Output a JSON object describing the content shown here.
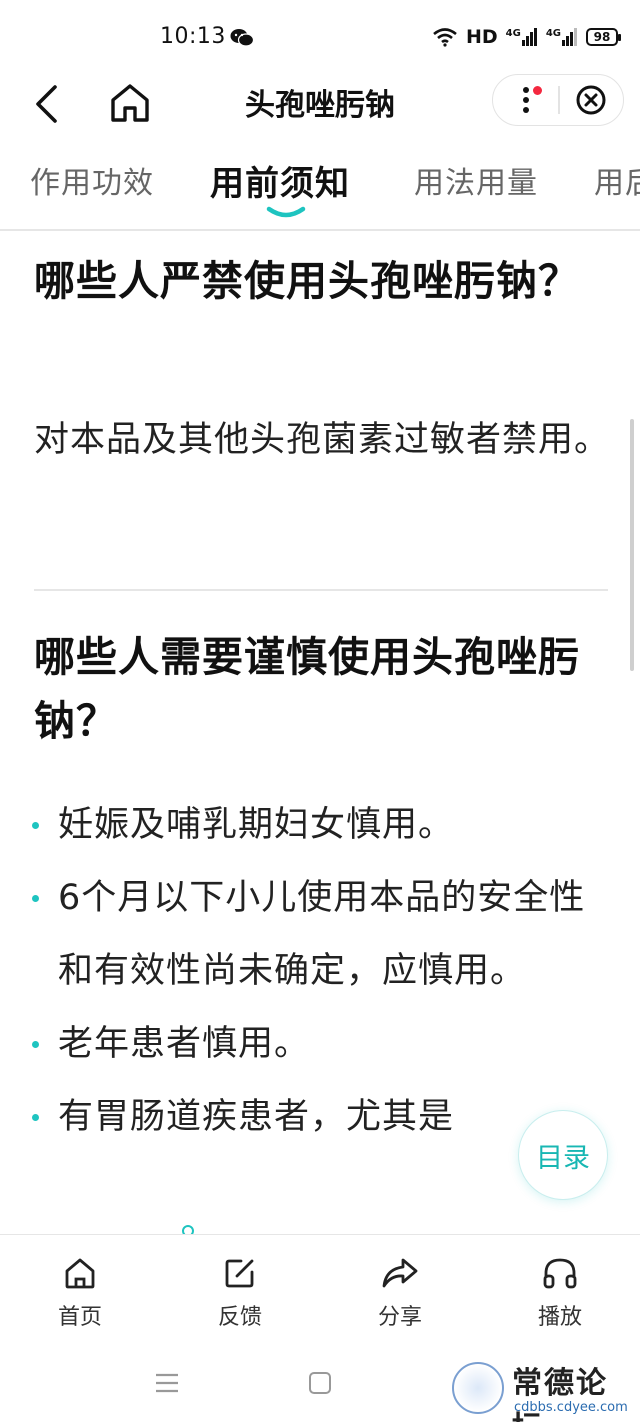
{
  "status_bar": {
    "time": "10:13",
    "network_label": "HD",
    "signal_1": "4G",
    "signal_2": "4G",
    "battery": "98"
  },
  "header": {
    "title": "头孢唑肟钠",
    "icons": {
      "back": "back-arrow-icon",
      "home": "home-icon",
      "more": "more-vertical-icon",
      "close": "close-circle-icon"
    }
  },
  "tabs": [
    {
      "label": "作用功效",
      "active": false
    },
    {
      "label": "用前须知",
      "active": true
    },
    {
      "label": "用法用量",
      "active": false
    },
    {
      "label": "用后",
      "active": false
    }
  ],
  "sections": [
    {
      "heading": "哪些人严禁使用头孢唑肟钠？",
      "body": "对本品及其他头孢菌素过敏者禁用。"
    },
    {
      "heading": "哪些人需要谨慎使用头孢唑肟钠？",
      "bullets": [
        "妊娠及哺乳期妇女慎用。",
        "6个月以下小儿使用本品的安全性和有效性尚未确定，应慎用。",
        "老年患者慎用。",
        "有胃肠道疾患者，尤其是"
      ]
    }
  ],
  "toc_button": "目录",
  "bottom_nav": [
    {
      "label": "首页",
      "icon": "home-icon"
    },
    {
      "label": "反馈",
      "icon": "edit-icon"
    },
    {
      "label": "分享",
      "icon": "share-icon"
    },
    {
      "label": "播放",
      "icon": "headphones-icon"
    }
  ],
  "watermark": {
    "title": "常德论坛",
    "url": "cdbbs.cdyee.com"
  },
  "colors": {
    "accent": "#1ec4c0",
    "notification_dot": "#f4283f",
    "text": "#111111"
  }
}
